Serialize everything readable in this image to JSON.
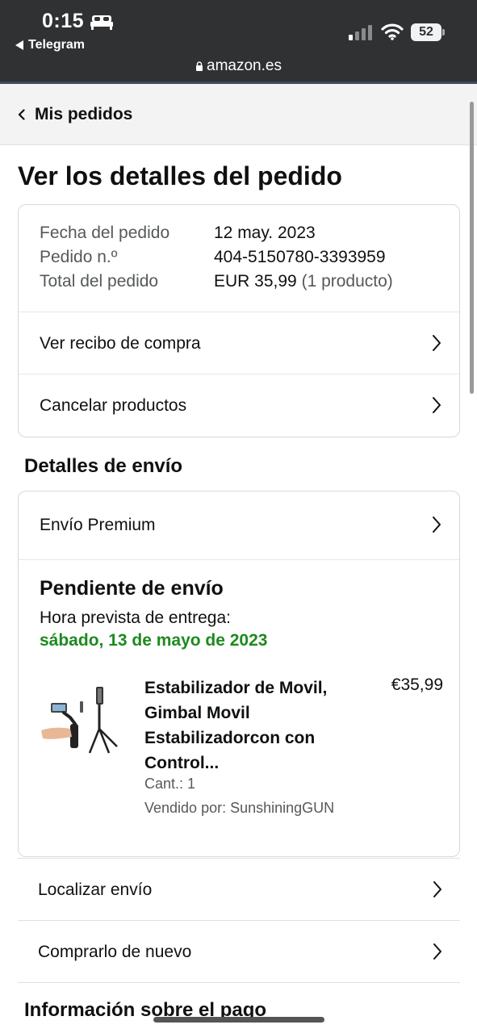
{
  "status_bar": {
    "time": "0:15",
    "back_app": "Telegram",
    "battery": "52",
    "url": "amazon.es"
  },
  "nav": {
    "back_label": "Mis pedidos"
  },
  "page_title": "Ver los detalles del pedido",
  "order": {
    "date_label": "Fecha del pedido",
    "date_value": "12 may. 2023",
    "number_label": "Pedido n.º",
    "number_value": "404-5150780-3393959",
    "total_label": "Total del pedido",
    "total_value": "EUR 35,99",
    "total_count": "(1 producto)",
    "receipt_link": "Ver recibo de compra",
    "cancel_link": "Cancelar productos"
  },
  "shipping": {
    "section_title": "Detalles de envío",
    "method": "Envío Premium",
    "status": "Pendiente de envío",
    "eta_label": "Hora prevista de entrega:",
    "eta_date": "sábado, 13 de mayo de 2023",
    "product": {
      "title": "Estabilizador de Movil, Gimbal Movil Estabilizadorcon con Control...",
      "price": "€35,99",
      "qty": "Cant.: 1",
      "seller": "Vendido por: SunshiningGUN"
    }
  },
  "actions": {
    "track": "Localizar envío",
    "buy_again": "Comprarlo de nuevo"
  },
  "payment_section_title": "Información sobre el pago",
  "colors": {
    "eta_green": "#1e8a1e",
    "statusbar_bg": "#2f3133"
  }
}
